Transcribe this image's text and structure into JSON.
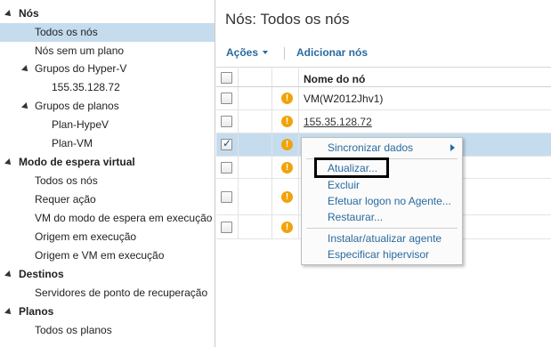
{
  "sidebar": {
    "items": [
      {
        "label": "Nós",
        "kind": "section",
        "expanded": true
      },
      {
        "label": "Todos os nós",
        "kind": "item",
        "selected": true
      },
      {
        "label": "Nós sem um plano",
        "kind": "item"
      },
      {
        "label": "Grupos do Hyper-V",
        "kind": "group",
        "expanded": true
      },
      {
        "label": "155.35.128.72",
        "kind": "item"
      },
      {
        "label": "Grupos de planos",
        "kind": "group",
        "expanded": true
      },
      {
        "label": "Plan-HypeV",
        "kind": "item"
      },
      {
        "label": "Plan-VM",
        "kind": "item"
      },
      {
        "label": "Modo de espera virtual",
        "kind": "section",
        "expanded": true
      },
      {
        "label": "Todos os nós",
        "kind": "item"
      },
      {
        "label": "Requer ação",
        "kind": "item"
      },
      {
        "label": "VM do modo de espera em execução",
        "kind": "item"
      },
      {
        "label": "Origem em execução",
        "kind": "item"
      },
      {
        "label": "Origem e VM em execução",
        "kind": "item"
      },
      {
        "label": "Destinos",
        "kind": "section",
        "expanded": true
      },
      {
        "label": "Servidores de ponto de recuperação",
        "kind": "item"
      },
      {
        "label": "Planos",
        "kind": "section",
        "expanded": true
      },
      {
        "label": "Todos os planos",
        "kind": "item"
      }
    ]
  },
  "main": {
    "title": "Nós:  Todos os nós",
    "toolbar": {
      "actions_label": "Ações",
      "add_nodes_label": "Adicionar nós"
    },
    "table": {
      "column_name_header": "Nome do nó",
      "rows": [
        {
          "name": "VM(W2012Jhv1)",
          "checked": false,
          "warning": true,
          "link": false
        },
        {
          "name": "155.35.128.72",
          "checked": false,
          "warning": true,
          "link": true
        },
        {
          "name": "",
          "checked": true,
          "warning": true,
          "link": false,
          "selected": true
        },
        {
          "name": "",
          "checked": false,
          "warning": true,
          "link": false
        },
        {
          "name": "",
          "checked": false,
          "warning": true,
          "link": false
        },
        {
          "name": "",
          "checked": false,
          "warning": true,
          "link": false
        }
      ]
    }
  },
  "context_menu": {
    "items": [
      {
        "label": "Sincronizar dados",
        "has_submenu": true
      },
      {
        "label": "Atualizar...",
        "highlighted": true
      },
      {
        "label": "Excluir"
      },
      {
        "label": "Efetuar logon no Agente..."
      },
      {
        "label": "Restaurar..."
      },
      {
        "label": "Instalar/atualizar agente"
      },
      {
        "label": "Especificar hipervisor"
      }
    ]
  },
  "colors": {
    "selection": "#c5dcef",
    "link_blue": "#2a6a9e",
    "warning": "#f0a30a"
  }
}
